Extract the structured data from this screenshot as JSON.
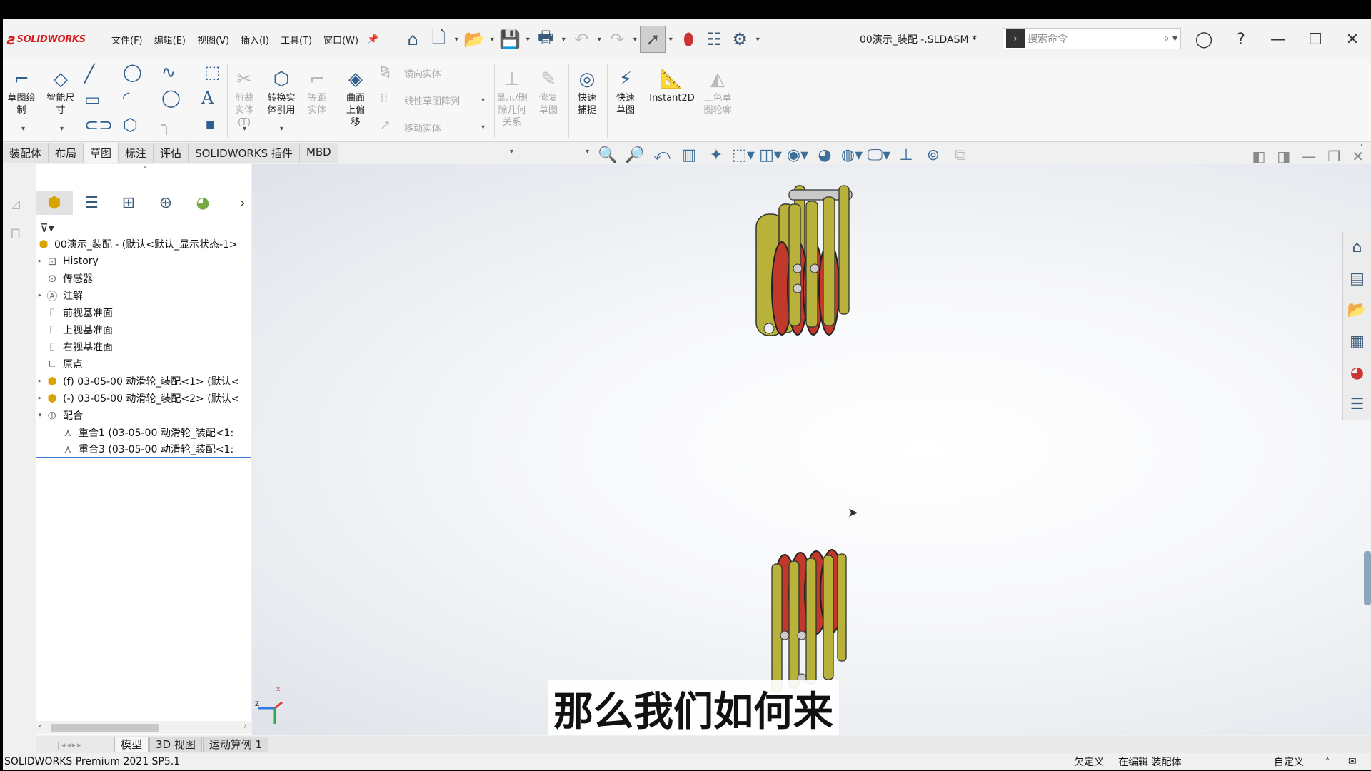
{
  "app": {
    "brand": "SOLIDWORKS",
    "document_title": "00演示_装配 -.SLDASM *",
    "menu": [
      "文件(F)",
      "编辑(E)",
      "视图(V)",
      "插入(I)",
      "工具(T)",
      "窗口(W)"
    ]
  },
  "search": {
    "placeholder": "搜索命令"
  },
  "ribbon": {
    "sketch": "草图绘制",
    "smart_dim": "智能尺寸",
    "trim": "剪裁实体(T)",
    "convert": "转换实体引用",
    "offset": "等距实体",
    "surface_offset": "曲面上偏移",
    "mirror": "镜向实体",
    "linear_pattern": "线性草图阵列",
    "move": "移动实体",
    "show_relations": "显示/删除几何关系",
    "repair": "修复草图",
    "quick_snap": "快速捕捉",
    "rapid_sketch": "快速草图",
    "instant2d": "Instant2D",
    "shaded": "上色草图轮廓"
  },
  "tabs": [
    "装配体",
    "布局",
    "草图",
    "标注",
    "评估",
    "SOLIDWORKS 插件",
    "MBD"
  ],
  "active_tab": "草图",
  "tree": {
    "root": "00演示_装配 - (默认<默认_显示状态-1>",
    "items": [
      {
        "label": "History",
        "expand": "▸",
        "icon": "history-icon"
      },
      {
        "label": "传感器",
        "expand": "",
        "icon": "sensor-icon"
      },
      {
        "label": "注解",
        "expand": "▸",
        "icon": "annotation-icon"
      },
      {
        "label": "前视基准面",
        "expand": "",
        "icon": "plane-icon"
      },
      {
        "label": "上视基准面",
        "expand": "",
        "icon": "plane-icon"
      },
      {
        "label": "右视基准面",
        "expand": "",
        "icon": "plane-icon"
      },
      {
        "label": "原点",
        "expand": "",
        "icon": "origin-icon"
      },
      {
        "label": "(f) 03-05-00 动滑轮_装配<1> (默认<",
        "expand": "▸",
        "icon": "assembly-icon"
      },
      {
        "label": "(-) 03-05-00 动滑轮_装配<2> (默认<",
        "expand": "▸",
        "icon": "assembly-icon"
      },
      {
        "label": "配合",
        "expand": "▾",
        "icon": "mates-icon"
      },
      {
        "label": "重合1 (03-05-00 动滑轮_装配<1:",
        "expand": "",
        "icon": "mate-icon"
      },
      {
        "label": "重合3 (03-05-00 动滑轮_装配<1:",
        "expand": "",
        "icon": "mate-icon"
      }
    ]
  },
  "bottom_tabs": [
    "模型",
    "3D 视图",
    "运动算例 1"
  ],
  "subtitle": "那么我们如何来",
  "status": {
    "product": "SOLIDWORKS Premium 2021 SP5.1",
    "defined": "欠定义",
    "editing": "在编辑 装配体",
    "custom": "自定义"
  },
  "colors": {
    "brand_red": "#d81e1e",
    "pulley_yellow": "#b9b23a",
    "sheave_red": "#c0392b"
  }
}
